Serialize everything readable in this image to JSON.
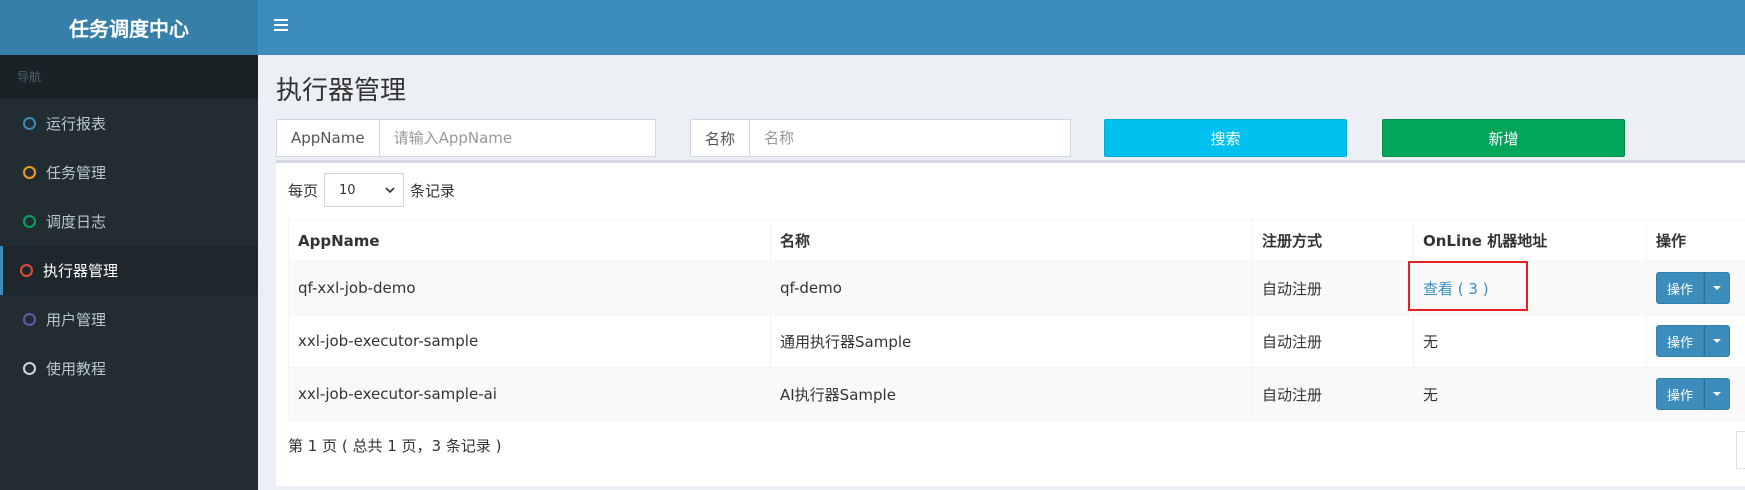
{
  "app": {
    "title": "任务调度中心"
  },
  "sidebar": {
    "header": "导航",
    "items": [
      {
        "label": "运行报表",
        "color": "#3c8dbc"
      },
      {
        "label": "任务管理",
        "color": "#f39c12"
      },
      {
        "label": "调度日志",
        "color": "#00a65a"
      },
      {
        "label": "执行器管理",
        "color": "#dd4b39",
        "active": true
      },
      {
        "label": "用户管理",
        "color": "#605ca8"
      },
      {
        "label": "使用教程",
        "color": "#d2d6de"
      }
    ]
  },
  "page": {
    "title": "执行器管理"
  },
  "filters": {
    "appname_label": "AppName",
    "appname_placeholder": "请输入AppName",
    "title_label": "名称",
    "title_placeholder": "名称",
    "search_button": "搜索",
    "add_button": "新增"
  },
  "table": {
    "length_prefix": "每页",
    "length_value": "10",
    "length_suffix": "条记录",
    "columns": [
      "AppName",
      "名称",
      "注册方式",
      "OnLine 机器地址",
      "操作"
    ],
    "rows": [
      {
        "appname": "qf-xxl-job-demo",
        "title": "qf-demo",
        "reg": "自动注册",
        "online": "查看 ( 3 )",
        "op": "操作"
      },
      {
        "appname": "xxl-job-executor-sample",
        "title": "通用执行器Sample",
        "reg": "自动注册",
        "online": "无",
        "op": "操作"
      },
      {
        "appname": "xxl-job-executor-sample-ai",
        "title": "AI执行器Sample",
        "reg": "自动注册",
        "online": "无",
        "op": "操作"
      }
    ],
    "info": "第 1 页 ( 总共 1 页，3 条记录 )"
  }
}
